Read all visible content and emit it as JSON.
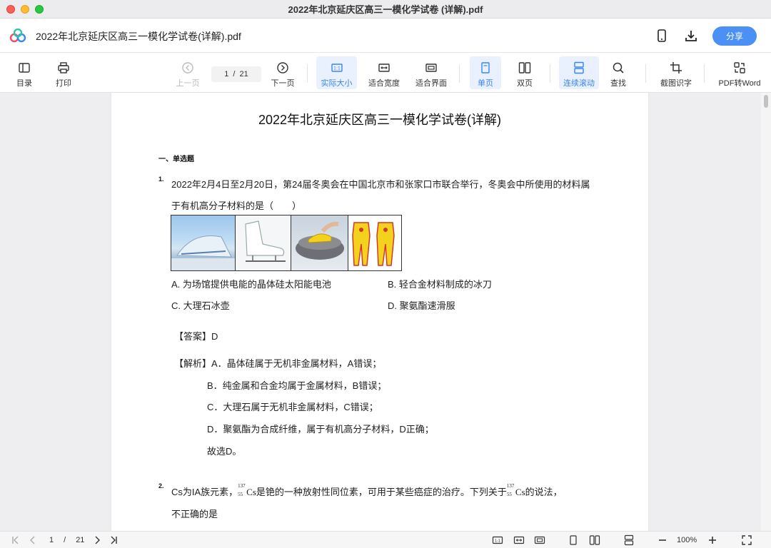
{
  "window": {
    "title": "2022年北京延庆区高三一模化学试卷 (详解).pdf"
  },
  "header": {
    "doc_title": "2022年北京延庆区高三一模化学试卷(详解).pdf",
    "share_label": "分享"
  },
  "toolbar": {
    "toc": "目录",
    "print": "打印",
    "prev": "上一页",
    "next": "下一页",
    "page_current": "1",
    "page_sep": "/",
    "page_total": "21",
    "actual_size": "实际大小",
    "fit_width": "适合宽度",
    "fit_page": "适合界面",
    "single": "单页",
    "double": "双页",
    "continuous": "连续滚动",
    "find": "查找",
    "ocr": "截图识字",
    "to_word": "PDF转Word"
  },
  "doc": {
    "title": "2022年北京延庆区高三一模化学试卷(详解)",
    "section": "一、单选题",
    "q1": {
      "num": "1.",
      "line1": "2022年2月4日至2月20日，第24届冬奥会在中国北京市和张家口市联合举行，冬奥会中所使用的材料属",
      "line2": "于有机高分子材料的是（　　）",
      "optA": "A. 为场馆提供电能的晶体硅太阳能电池",
      "optB": "B. 轻合金材料制成的冰刀",
      "optC": "C. 大理石冰壶",
      "optD": "D. 聚氨酯速滑服",
      "answer": "【答案】D",
      "exp1": "【解析】A．晶体硅属于无机非金属材料，A错误；",
      "exp2": "B．纯金属和合金均属于金属材料，B错误；",
      "exp3": "C．大理石属于无机非金属材料，C错误；",
      "exp4": "D．聚氨酯为合成纤维，属于有机高分子材料，D正确；",
      "exp5": "故选D。"
    },
    "q2": {
      "num": "2.",
      "part1": "Cs为IA族元素，",
      "iso_a": "137",
      "iso_z": "55",
      "iso_el": "Cs",
      "part2": "是铯的一种放射性同位素，可用于某些癌症的治疗。下列关于",
      "part3": "的说法，",
      "line2": "不正确的是"
    }
  },
  "bottom": {
    "page_current": "1",
    "page_sep": "/",
    "page_total": "21",
    "zoom": "100%"
  },
  "colors": {
    "accent": "#4a90f5",
    "active_bg": "#e8f1fd"
  }
}
